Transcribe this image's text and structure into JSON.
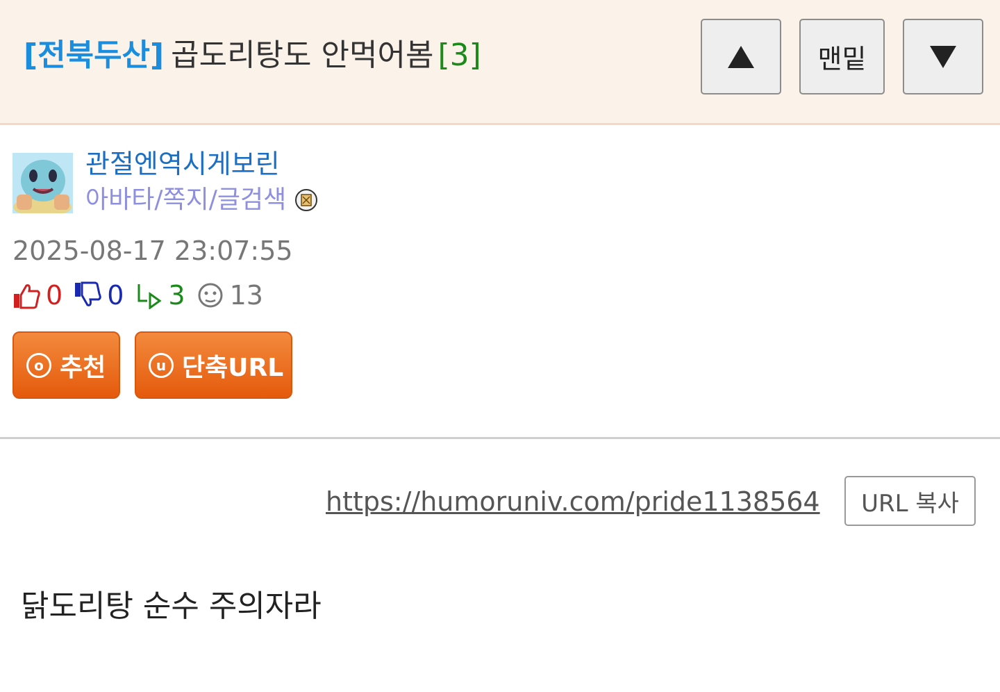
{
  "header": {
    "category": "[전북두산]",
    "subject": "곱도리탕도 안먹어봄",
    "comment_count": "[3]",
    "bottom_button_label": "맨밑"
  },
  "author": {
    "nickname": "관절엔역시게보린",
    "links": "아바타/쪽지/글검색"
  },
  "post": {
    "datetime": "2025-08-17 23:07:55",
    "stats": {
      "upvotes": "0",
      "downvotes": "0",
      "replies": "3",
      "views": "13"
    },
    "recommend_label": "추천",
    "recommend_icon_letter": "o",
    "short_url_label": "단축URL",
    "short_url_icon_letter": "u",
    "url": "https://humoruniv.com/pride1138564",
    "url_copy_label": "URL 복사",
    "body": "닭도리탕 순수 주의자라"
  },
  "colors": {
    "header_bg": "#fbf2ea",
    "category": "#1a8ddf",
    "comment_count": "#1a8a1a",
    "nickname": "#1a6fc4",
    "links": "#8f8fe0",
    "upvote": "#d21f1f",
    "downvote": "#1a2ab0",
    "button_orange": "#e55a0c"
  },
  "icons": {
    "up_nav": "triangle-up-icon",
    "down_nav": "triangle-down-icon",
    "memo": "memo-icon",
    "thumbs_up": "thumbs-up-icon",
    "thumbs_down": "thumbs-down-icon",
    "reply": "reply-icon",
    "views": "face-icon"
  }
}
